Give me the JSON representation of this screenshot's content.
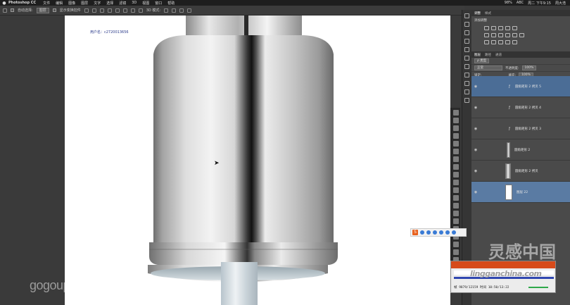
{
  "menubar": {
    "apple": "",
    "app_name": "Photoshop CC",
    "items": [
      "文件",
      "编辑",
      "图像",
      "图层",
      "文字",
      "选择",
      "滤镜",
      "3D",
      "视图",
      "窗口",
      "帮助"
    ],
    "status": [
      "ABC",
      "周二 下午9:15",
      "周大浩"
    ],
    "battery": "98%"
  },
  "options_bar": {
    "auto_select_label": "自动选择:",
    "auto_select_value": "图层",
    "transform_label": "显示变换控件",
    "mode_3d_label": "3D 模式:"
  },
  "canvas": {
    "username": "用户名：c2720013656"
  },
  "watermark": {
    "site": "gogoup.com"
  },
  "right_panel": {
    "tabs": [
      "调整",
      "样式"
    ],
    "adjust_title": "添加调整",
    "layers_tabs": [
      "图层",
      "路径",
      "通道"
    ],
    "kind_label": "ρ 类型",
    "blend_mode": "正常",
    "opacity_label": "不透明度:",
    "opacity_value": "100%",
    "lock_label": "锁定:",
    "fill_label": "填充:",
    "fill_value": "100%"
  },
  "layers": [
    {
      "name": "圆角矩形 2 拷贝 5",
      "style": "blue",
      "kind": "fx"
    },
    {
      "name": "圆角矩形 2 拷贝 4",
      "style": "normal",
      "kind": "fx"
    },
    {
      "name": "圆角矩形 2 拷贝 3",
      "style": "normal",
      "kind": "fx"
    },
    {
      "name": "圆角矩形 2",
      "style": "normal",
      "kind": "thumb"
    },
    {
      "name": "圆角矩形 2 拷贝",
      "style": "normal",
      "kind": "thumb"
    },
    {
      "name": "图层 22",
      "style": "selected",
      "kind": "thumb"
    }
  ],
  "overlay": {
    "brand_cn": "灵感中国",
    "brand_url": "lingganchina.com"
  },
  "player": {
    "info": "帧 9879/12159 时间 10:50/13:22"
  }
}
